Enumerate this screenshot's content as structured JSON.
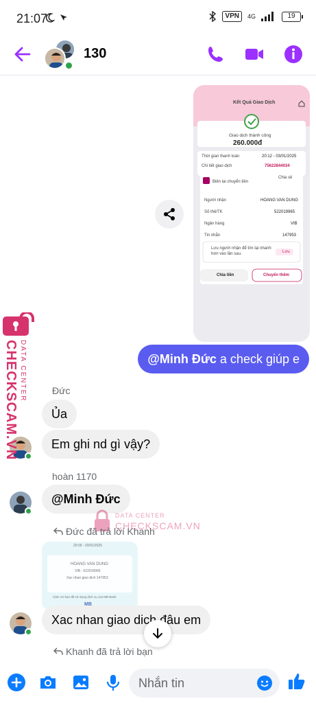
{
  "status_bar": {
    "time": "21:07",
    "vpn": "VPN",
    "network": "4G",
    "battery": "19"
  },
  "header": {
    "title": "130"
  },
  "shared_screenshot": {
    "title": "Kết Quả Giao Dịch",
    "status": "Giao dịch thành công",
    "amount": "260.000đ",
    "time_label": "Thời gian thanh toán",
    "time_value": "20:12 - 03/01/2025",
    "detail_label": "Chi tiết giao dịch",
    "detail_value": "75622844034",
    "receipt_label": "Biên lai chuyển tiền",
    "share_label": "Chia sẻ",
    "receiver_label": "Người nhận",
    "receiver_value": "HOANG VAN DUNG",
    "account_label": "Số thẻ/TK",
    "account_value": "522019965",
    "bank_label": "Ngân hàng",
    "bank_value": "VIB",
    "message_label": "Tin nhắn",
    "message_value": "147953",
    "save_hint": "Lưu người nhận để tìm lại nhanh hơn vào lần sau.",
    "save_label": "Lưu",
    "split_label": "Chia tiền",
    "transfer_more_label": "Chuyển thêm"
  },
  "messages": {
    "outgoing_mention": "@Minh Đức",
    "outgoing_text": " a check giúp e",
    "sender_duc": "Đức",
    "msg_ua": "Ủa",
    "msg_ghi_nd": "Em ghi nd gì vậy?",
    "sender_hoan": "hoàn 1170",
    "msg_mention": "@Minh Đức",
    "reply_note_1": "Đức đã trả lời Khanh",
    "reply_thumb_date": "20:09 - 03/01/2025",
    "reply_thumb_name": "HOANG VAN DUNG",
    "reply_thumb_account": "VIB - 522019965",
    "reply_thumb_code": "Xac nhan giao dich 147953",
    "reply_thumb_footer": "Cảm ơn bạn đã sử dụng dịch vụ của MB Bank",
    "reply_thumb_logo": "MB",
    "msg_xac_nhan": "Xac nhan giao dich đâu em",
    "reply_note_2": "Khanh đã trả lời bạn"
  },
  "composer": {
    "placeholder": "Nhắn tin"
  },
  "watermark": {
    "brand": "CHECKSCAM.VN",
    "sub": "DATA CENTER"
  },
  "colors": {
    "accent": "#9b30ff",
    "outgoing_bubble": "#5a5cf0",
    "incoming_bubble": "#f0f0f0",
    "online": "#31a24c",
    "composer_icons": "#0a7cff",
    "watermark": "#d6336c"
  }
}
